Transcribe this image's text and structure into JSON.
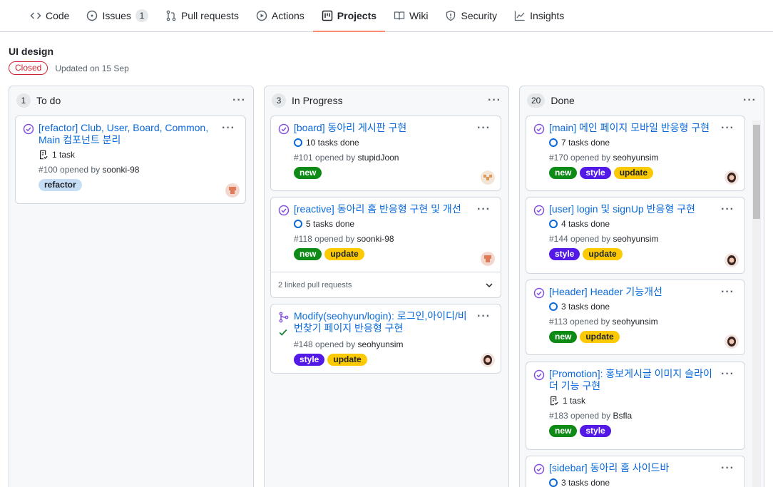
{
  "nav": {
    "tabs": [
      {
        "label": "Code",
        "icon": "code-icon"
      },
      {
        "label": "Issues",
        "icon": "issue-opened-icon",
        "count": "1"
      },
      {
        "label": "Pull requests",
        "icon": "git-pull-request-icon"
      },
      {
        "label": "Actions",
        "icon": "play-icon"
      },
      {
        "label": "Projects",
        "icon": "project-icon",
        "selected": true
      },
      {
        "label": "Wiki",
        "icon": "book-icon"
      },
      {
        "label": "Security",
        "icon": "shield-icon"
      },
      {
        "label": "Insights",
        "icon": "graph-icon"
      }
    ]
  },
  "project": {
    "title": "UI design",
    "state": "Closed",
    "updated": "Updated on 15 Sep"
  },
  "columns": [
    {
      "count": "1",
      "name": "To do",
      "cards": [
        {
          "title": "[refactor] Club, User, Board, Common, Main 컴포넌트 분리",
          "tasks": "1 task",
          "opened": "#100 opened by",
          "user": "soonki-98",
          "labels": [
            "refactor"
          ]
        }
      ]
    },
    {
      "count": "3",
      "name": "In Progress",
      "cards": [
        {
          "title": "[board] 동아리 게시판 구현",
          "tasks": "10 tasks done",
          "opened": "#101 opened by",
          "user": "stupidJoon",
          "labels": [
            "new"
          ]
        },
        {
          "title": "[reactive] 동아리 홈 반응형 구현 및 개선",
          "tasks": "5 tasks done",
          "opened": "#118 opened by",
          "user": "soonki-98",
          "labels": [
            "new",
            "update"
          ],
          "linked": "2 linked pull requests"
        },
        {
          "title": "Modify(seohyun/login): 로그인,아이디/비번찾기 페이지 반응형 구현",
          "opened": "#148 opened by",
          "user": "seohyunsim",
          "labels": [
            "style",
            "update"
          ]
        }
      ]
    },
    {
      "count": "20",
      "name": "Done",
      "cards": [
        {
          "title": "[main] 메인 페이지 모바일 반응형 구현",
          "tasks": "7 tasks done",
          "opened": "#170 opened by",
          "user": "seohyunsim",
          "labels": [
            "new",
            "style",
            "update"
          ]
        },
        {
          "title": "[user] login 및 signUp 반응형 구현",
          "tasks": "4 tasks done",
          "opened": "#144 opened by",
          "user": "seohyunsim",
          "labels": [
            "style",
            "update"
          ]
        },
        {
          "title": "[Header] Header 기능개선",
          "tasks": "3 tasks done",
          "opened": "#113 opened by",
          "user": "seohyunsim",
          "labels": [
            "new",
            "update"
          ]
        },
        {
          "title": "[Promotion]: 홍보게시글 이미지 슬라이더 기능 구현",
          "tasks": "1 task",
          "opened": "#183 opened by",
          "user": "Bsfla",
          "labels": [
            "new",
            "style"
          ]
        },
        {
          "title": "[sidebar] 동아리 홈 사이드바",
          "tasks": "3 tasks done"
        }
      ]
    }
  ],
  "colors": {
    "accent": "#0969da",
    "closed": "#cf222e",
    "done_purple": "#8250df",
    "label_new": "#0e8a16",
    "label_style": "#5319e7",
    "label_update": "#fbca04",
    "label_refactor": "#c5def5"
  }
}
